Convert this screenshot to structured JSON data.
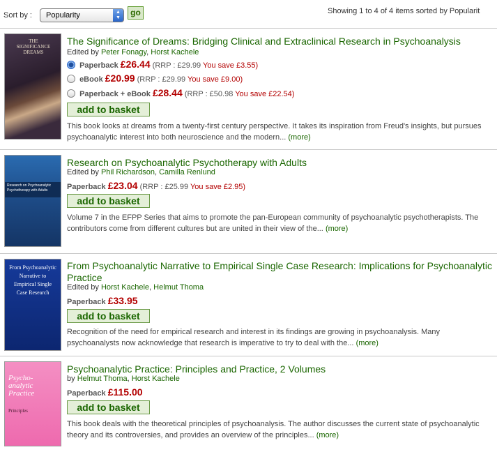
{
  "sort": {
    "label": "Sort by :",
    "selected": "Popularity",
    "go_label": "go",
    "showing": "Showing 1 to 4 of 4 items sorted by Popularit"
  },
  "items": [
    {
      "title": "The Significance of Dreams: Bridging Clinical and Extraclinical Research in Psychoanalysis",
      "prefix": "Edited by",
      "authors": [
        "Peter Fonagy",
        "Horst Kachele"
      ],
      "formats": [
        {
          "selected": true,
          "name": "Paperback",
          "price": "£26.44",
          "rrp": "(RRP : £29.99",
          "save": "You save £3.55)"
        },
        {
          "selected": false,
          "name": "eBook",
          "price": "£20.99",
          "rrp": "(RRP : £29.99",
          "save": "You save £9.00)"
        },
        {
          "selected": false,
          "name": "Paperback + eBook",
          "price": "£28.44",
          "rrp": "(RRP : £50.98",
          "save": "You save £22.54)"
        }
      ],
      "basket": "add to basket",
      "desc": "This book looks at dreams from a twenty-first century perspective. It takes its inspiration from Freud's insights, but pursues psychoanalytic interest into both neuroscience and the modern...",
      "more": "(more)",
      "cover": {
        "line1": "THE",
        "line2": "SIGNIFICANCE",
        "line3": "DREAMS",
        "bg": "#3a2a3c"
      }
    },
    {
      "title": "Research on Psychoanalytic Psychotherapy with Adults",
      "prefix": "Edited by",
      "authors": [
        "Phil Richardson",
        "Camilla Renlund"
      ],
      "formats": [
        {
          "name": "Paperback",
          "price": "£23.04",
          "rrp": "(RRP : £25.99",
          "save": "You save £2.95)"
        }
      ],
      "basket": "add to basket",
      "desc": "Volume 7 in the EFPP Series that aims to promote the pan-European community of psychoanalytic psychotherapists. The contributors come from different cultures but are united in their view of the...",
      "more": "(more)",
      "cover": {
        "line1": "Research on Psychoanalytic",
        "line2": "Psychotherapy with Adults",
        "bg": "#1f4f86"
      }
    },
    {
      "title": "From Psychoanalytic Narrative to Empirical Single Case Research: Implications for Psychoanalytic Practice",
      "prefix": "Edited by",
      "authors": [
        "Horst Kachele",
        "Helmut Thoma"
      ],
      "formats": [
        {
          "name": "Paperback",
          "price": "£33.95"
        }
      ],
      "basket": "add to basket",
      "desc": "Recognition of the need for empirical research and interest in its findings are growing in psychoanalysis. Many psychoanalysts now acknowledge that research is imperative to try to deal with the...",
      "more": "(more)",
      "cover": {
        "line1": "From Psychoanalytic",
        "line2": "Narrative to",
        "line3": "Empirical Single",
        "line4": "Case Research",
        "bg": "#0f2a80"
      }
    },
    {
      "title": "Psychoanalytic Practice: Principles and Practice, 2 Volumes",
      "prefix": "by",
      "authors": [
        "Helmut Thoma",
        "Horst Kachele"
      ],
      "formats": [
        {
          "name": "Paperback",
          "price": "£115.00"
        }
      ],
      "basket": "add to basket",
      "desc": "This book deals with the theoretical principles of psychoanalysis. The author discusses the current state of psychoanalytic theory and its controversies, and provides an overview of the principles...",
      "more": "(more)",
      "cover": {
        "line1": "Psycho-",
        "line2": "analytic",
        "line3": "Practice",
        "line4": "Principles",
        "bg": "#f07ab5"
      }
    }
  ]
}
